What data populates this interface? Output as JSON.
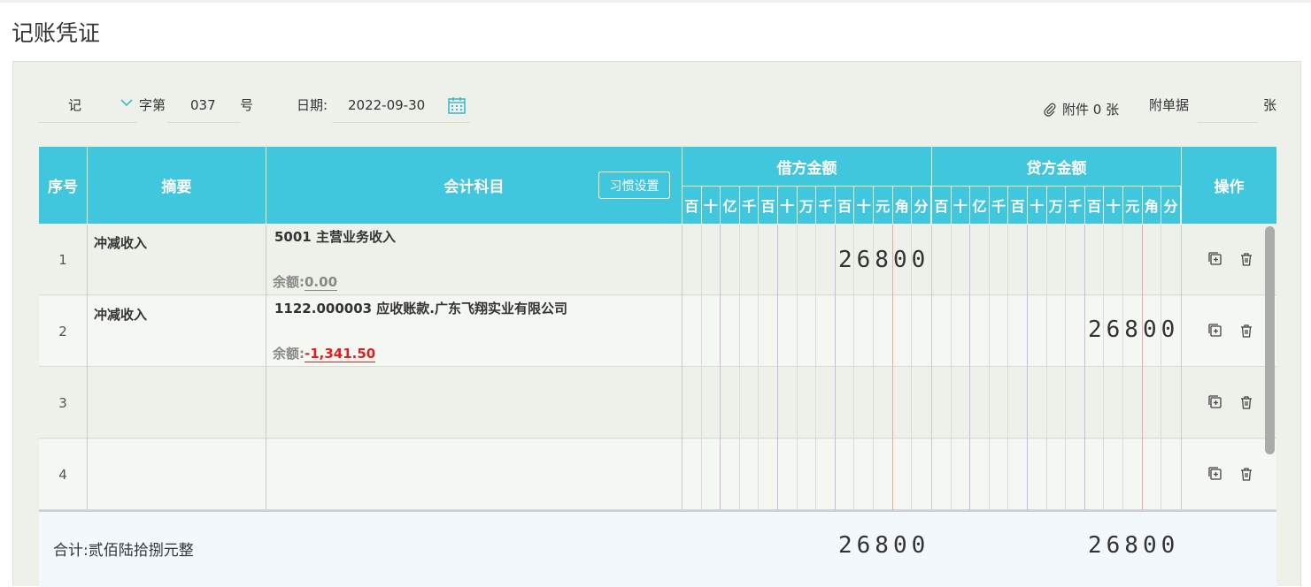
{
  "page_title": "记账凭证",
  "header": {
    "voucher_type": "记",
    "zi_di": "字第",
    "voucher_number": "037",
    "hao": "号",
    "date_label": "日期:",
    "date_value": "2022-09-30",
    "attachments": "附件 0 张",
    "attached_docs_label": "附单据",
    "attached_docs_value": "",
    "zhang": "张"
  },
  "table": {
    "headers": {
      "seq": "序号",
      "summary": "摘要",
      "account": "会计科目",
      "habit_settings": "习惯设置",
      "debit": "借方金额",
      "credit": "贷方金额",
      "ops": "操作"
    },
    "units": [
      "百",
      "十",
      "亿",
      "千",
      "百",
      "十",
      "万",
      "千",
      "百",
      "十",
      "元",
      "角",
      "分"
    ],
    "rows": [
      {
        "seq": "1",
        "summary": "冲减收入",
        "account": "5001 主营业务收入",
        "balance_label": "余额:",
        "balance": "0.00",
        "debit": "26800",
        "credit": ""
      },
      {
        "seq": "2",
        "summary": "冲减收入",
        "account": "1122.000003 应收账款.广东飞翔实业有限公司",
        "balance_label": "余额:",
        "balance": "-1,341.50",
        "debit": "",
        "credit": "26800"
      },
      {
        "seq": "3",
        "summary": "",
        "account": "",
        "balance_label": "",
        "balance": "",
        "debit": "",
        "credit": ""
      },
      {
        "seq": "4",
        "summary": "",
        "account": "",
        "balance_label": "",
        "balance": "",
        "debit": "",
        "credit": ""
      }
    ],
    "total": {
      "label": "合计:贰佰陆拾捌元整",
      "debit": "26800",
      "credit": "26800"
    }
  },
  "colors": {
    "header_bg": "#41c7dd",
    "accent": "#3fb8d2",
    "negative": "#e02020"
  }
}
